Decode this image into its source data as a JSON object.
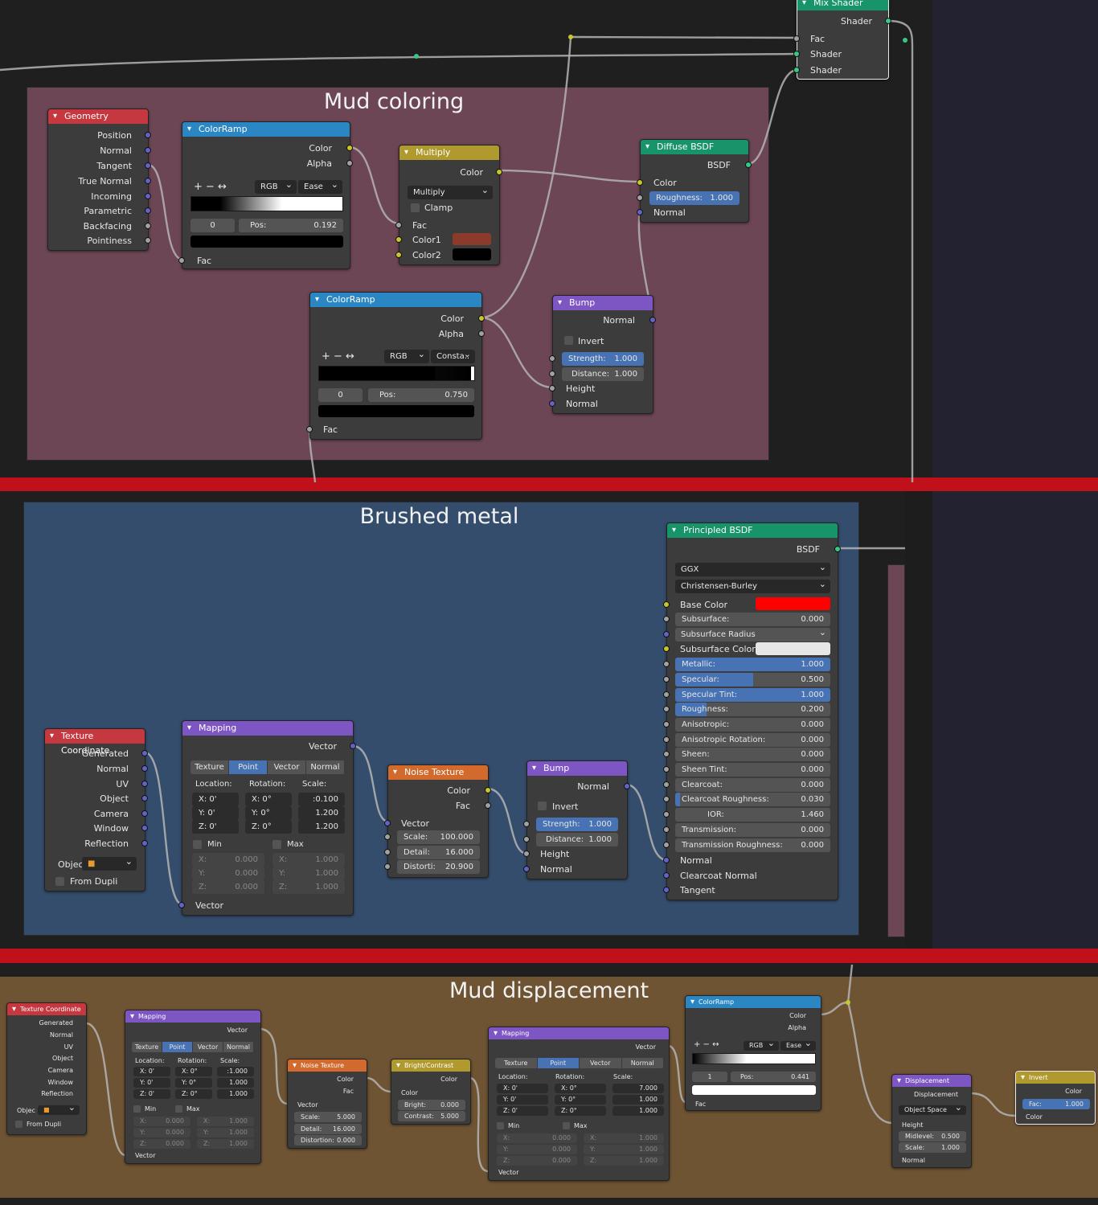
{
  "frames": {
    "mud_coloring": "Mud coloring",
    "brushed_metal": "Brushed metal",
    "mud_displacement": "Mud displacement"
  },
  "mix": {
    "title": "Mix Shader",
    "out": "Shader",
    "in1": "Fac",
    "in2": "Shader",
    "in3": "Shader"
  },
  "geo": {
    "title": "Geometry",
    "outs": [
      "Position",
      "Normal",
      "Tangent",
      "True Normal",
      "Incoming",
      "Parametric",
      "Backfacing",
      "Pointiness"
    ]
  },
  "cr1": {
    "title": "ColorRamp",
    "color": "Color",
    "alpha": "Alpha",
    "btns": "+ − ↔",
    "mode": "RGB",
    "interp": "Ease",
    "idx": "0",
    "pos_label": "Pos:",
    "pos": "0.192",
    "fac": "Fac"
  },
  "mul": {
    "title": "Multiply",
    "color": "Color",
    "op": "Multiply",
    "clamp": "Clamp",
    "fac": "Fac",
    "c1": "Color1",
    "c2": "Color2",
    "c1_hex": "#8c3a2a"
  },
  "dif": {
    "title": "Diffuse BSDF",
    "out": "BSDF",
    "color": "Color",
    "rough_label": "Roughness:",
    "rough": "1.000",
    "normal": "Normal"
  },
  "cr2": {
    "title": "ColorRamp",
    "color": "Color",
    "alpha": "Alpha",
    "btns": "+ − ↔",
    "mode": "RGB",
    "interp": "Consta..",
    "idx": "0",
    "pos_label": "Pos:",
    "pos": "0.750",
    "fac": "Fac"
  },
  "bump1": {
    "title": "Bump",
    "normal": "Normal",
    "invert": "Invert",
    "str_label": "Strength:",
    "str": "1.000",
    "dist_label": "Distance:",
    "dist": "1.000",
    "height": "Height",
    "normal_in": "Normal"
  },
  "pbsdf": {
    "title": "Principled BSDF",
    "out": "BSDF",
    "dist": "GGX",
    "sss": "Christensen-Burley",
    "base": "Base Color",
    "base_hex": "#ff0000",
    "params": [
      {
        "l": "Subsurface:",
        "v": "0.000",
        "f": 0
      },
      {
        "l": "Subsurface Radius",
        "v": "",
        "f": 0,
        "sel": true
      },
      {
        "l": "Subsurface Color",
        "v": "",
        "f": 0,
        "col": true
      },
      {
        "l": "Metallic:",
        "v": "1.000",
        "f": 1
      },
      {
        "l": "Specular:",
        "v": "0.500",
        "f": 0.5
      },
      {
        "l": "Specular Tint:",
        "v": "1.000",
        "f": 1
      },
      {
        "l": "Roughness:",
        "v": "0.200",
        "f": 0.2
      },
      {
        "l": "Anisotropic:",
        "v": "0.000",
        "f": 0
      },
      {
        "l": "Anisotropic Rotation:",
        "v": "0.000",
        "f": 0
      },
      {
        "l": "Sheen:",
        "v": "0.000",
        "f": 0
      },
      {
        "l": "Sheen Tint:",
        "v": "0.000",
        "f": 0
      },
      {
        "l": "Clearcoat:",
        "v": "0.000",
        "f": 0
      },
      {
        "l": "Clearcoat Roughness:",
        "v": "0.030",
        "f": 0.03
      },
      {
        "l": "IOR:",
        "v": "1.460",
        "f": 0,
        "center": true
      },
      {
        "l": "Transmission:",
        "v": "0.000",
        "f": 0
      },
      {
        "l": "Transmission Roughness:",
        "v": "0.000",
        "f": 0
      }
    ],
    "normal": "Normal",
    "cnormal": "Clearcoat Normal",
    "tangent": "Tangent"
  },
  "tc": {
    "title": "Texture Coordinate",
    "outs": [
      "Generated",
      "Normal",
      "UV",
      "Object",
      "Camera",
      "Window",
      "Reflection"
    ],
    "obj": "Objec",
    "dupli": "From Dupli"
  },
  "map": {
    "title": "Mapping",
    "vector": "Vector",
    "tabs": [
      "Texture",
      "Point",
      "Vector",
      "Normal"
    ],
    "loc": "Location:",
    "rot": "Rotation:",
    "scale": "Scale:",
    "locv": [
      "X:  0'",
      "Y:  0'",
      "Z:  0'"
    ],
    "rotv": [
      "X:  0°",
      "Y:  0°",
      "Z:  0°"
    ],
    "min": "Min",
    "max": "Max",
    "minv": [
      "X:",
      "Y:",
      "Z:"
    ],
    "zero": "0.000",
    "one": "1.000",
    "vin": "Vector"
  },
  "map1_scale": [
    ":0.100",
    "1.200",
    "1.200"
  ],
  "noise1": {
    "title": "Noise Texture",
    "color": "Color",
    "fac": "Fac",
    "vector": "Vector",
    "scale_l": "Scale:",
    "scale": "100.000",
    "detail_l": "Detail:",
    "detail": "16.000",
    "dist_l": "Distorti:",
    "dist": "20.900"
  },
  "bump2": {
    "title": "Bump",
    "normal": "Normal",
    "invert": "Invert",
    "str_label": "Strength:",
    "str": "1.000",
    "dist_label": "Distance:",
    "dist": "1.000",
    "height": "Height",
    "normal_in": "Normal"
  },
  "map2_scale": [
    ":1.000",
    "1.000",
    "1.000"
  ],
  "map3_scale": [
    "7.000",
    "1.000",
    "1.000"
  ],
  "noise2": {
    "title": "Noise Texture",
    "color": "Color",
    "fac": "Fac",
    "vector": "Vector",
    "scale_l": "Scale:",
    "scale": "5.000",
    "detail_l": "Detail:",
    "detail": "16.000",
    "dist_l": "Distortion:",
    "dist": "0.000"
  },
  "bc": {
    "title": "Bright/Contrast",
    "color": "Color",
    "cin": "Color",
    "bright_l": "Bright:",
    "bright": "0.000",
    "contrast_l": "Contrast:",
    "contrast": "5.000"
  },
  "cr3": {
    "title": "ColorRamp",
    "color": "Color",
    "alpha": "Alpha",
    "btns": "+ − ↔",
    "mode": "RGB",
    "interp": "Ease",
    "idx": "1",
    "pos_label": "Pos:",
    "pos": "0.441",
    "fac": "Fac"
  },
  "disp": {
    "title": "Displacement",
    "out": "Displacement",
    "space": "Object Space",
    "height": "Height",
    "mid_l": "Midlevel:",
    "mid": "0.500",
    "scale_l": "Scale:",
    "scale": "1.000",
    "normal": "Normal"
  },
  "inv": {
    "title": "Invert",
    "color": "Color",
    "fac_l": "Fac:",
    "fac": "1.000",
    "cin": "Color"
  },
  "colors": {
    "geometry_header": "#c6383f",
    "converter_header": "#2b86c4",
    "math_header": "#b09a2e",
    "shader_header": "#17946a",
    "vector_header": "#7e56c4",
    "texture_header": "#d2692d",
    "mud_frame": "#6d4656",
    "metal_frame": "#354d6c",
    "disp_frame": "#6f5434",
    "separator": "#c0101a"
  }
}
